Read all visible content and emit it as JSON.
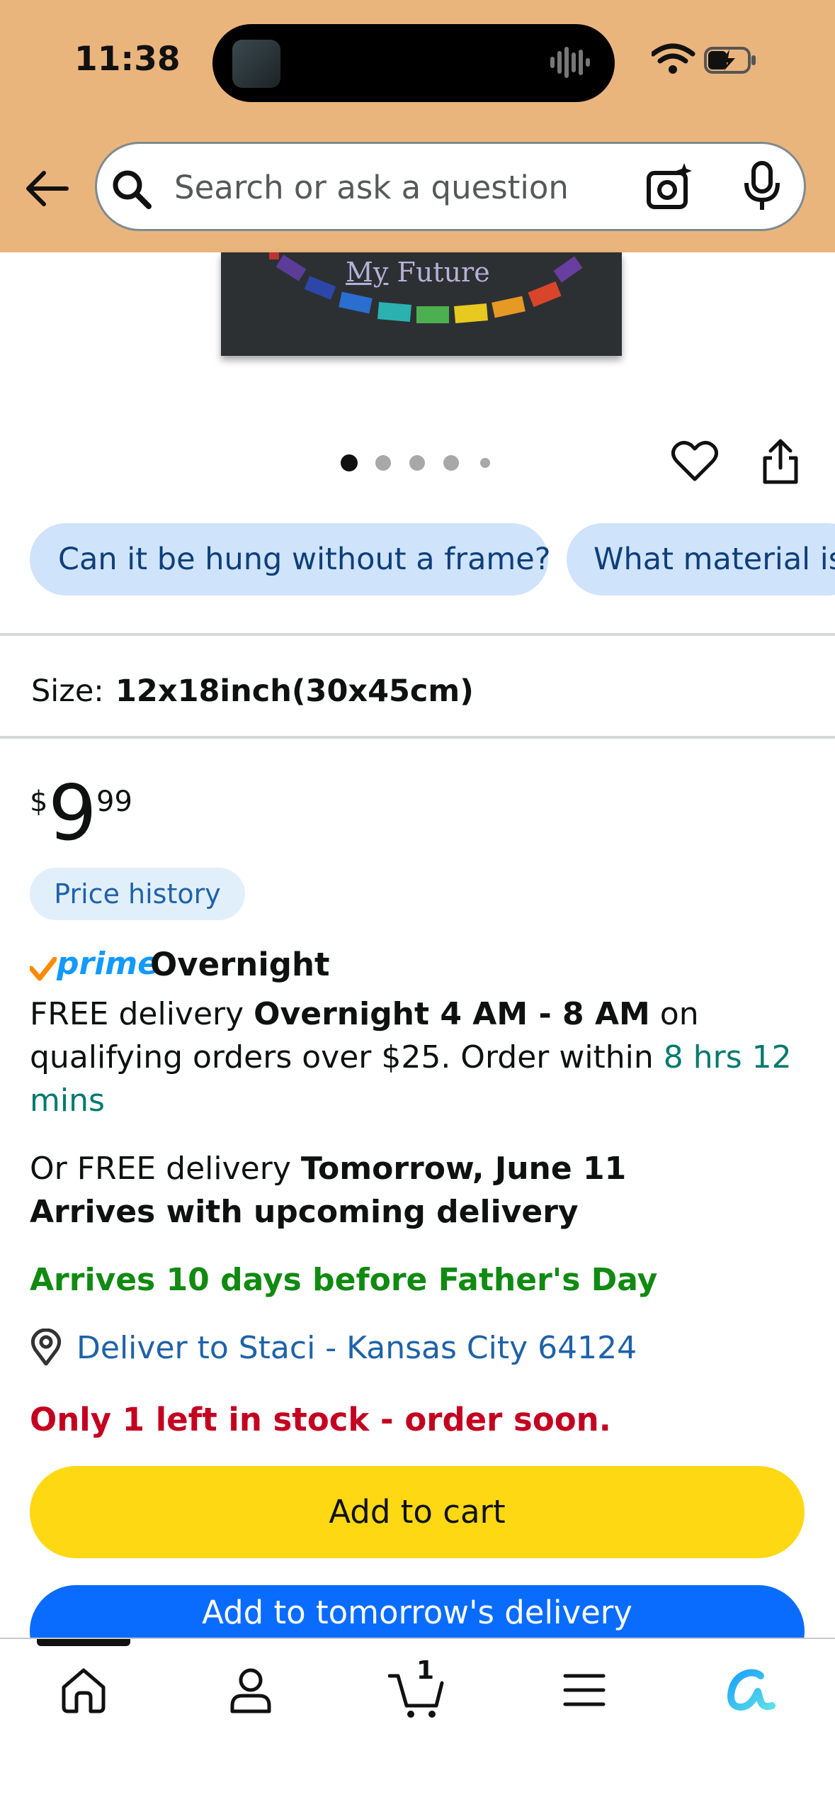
{
  "status_bar": {
    "time": "11:38"
  },
  "search": {
    "placeholder": "Search or ask a question"
  },
  "product_image": {
    "caption_underlined": "My",
    "caption_rest": " Future"
  },
  "carousel": {
    "total": 5,
    "active_index": 0
  },
  "question_chips": [
    "Can it be hung without a frame?",
    "What material is"
  ],
  "size": {
    "label": "Size:",
    "value": "12x18inch(30x45cm)"
  },
  "price": {
    "currency": "$",
    "whole": "9",
    "cents": "99",
    "history_label": "Price history"
  },
  "prime": {
    "word": "prime",
    "speed": "Overnight"
  },
  "delivery_primary": {
    "prefix": "FREE delivery ",
    "window": "Overnight 4 AM - 8 AM",
    "middle": " on qualifying orders over $25. Order within ",
    "countdown": "8 hrs 12 mins"
  },
  "delivery_secondary": {
    "prefix": "Or FREE delivery ",
    "date": "Tomorrow, June 11",
    "note": "Arrives with upcoming delivery"
  },
  "fathers_day": "Arrives 10 days before Father's Day",
  "deliver_to": "Deliver to Staci - Kansas City 64124",
  "stock": "Only 1 left in stock - order soon.",
  "buttons": {
    "add_to_cart": "Add to cart",
    "add_tomorrow": "Add to tomorrow's delivery"
  },
  "bottom_nav": {
    "items": [
      "home-icon",
      "account-icon",
      "cart-icon",
      "menu-icon",
      "rufus-ai-icon"
    ],
    "cart_count": "1"
  },
  "colors": {
    "header": "#eab57c",
    "add_to_cart": "#ffd814",
    "add_tomorrow": "#0a6cff",
    "stock_red": "#c40020",
    "green": "#118a11",
    "link_blue": "#1f62a8"
  }
}
